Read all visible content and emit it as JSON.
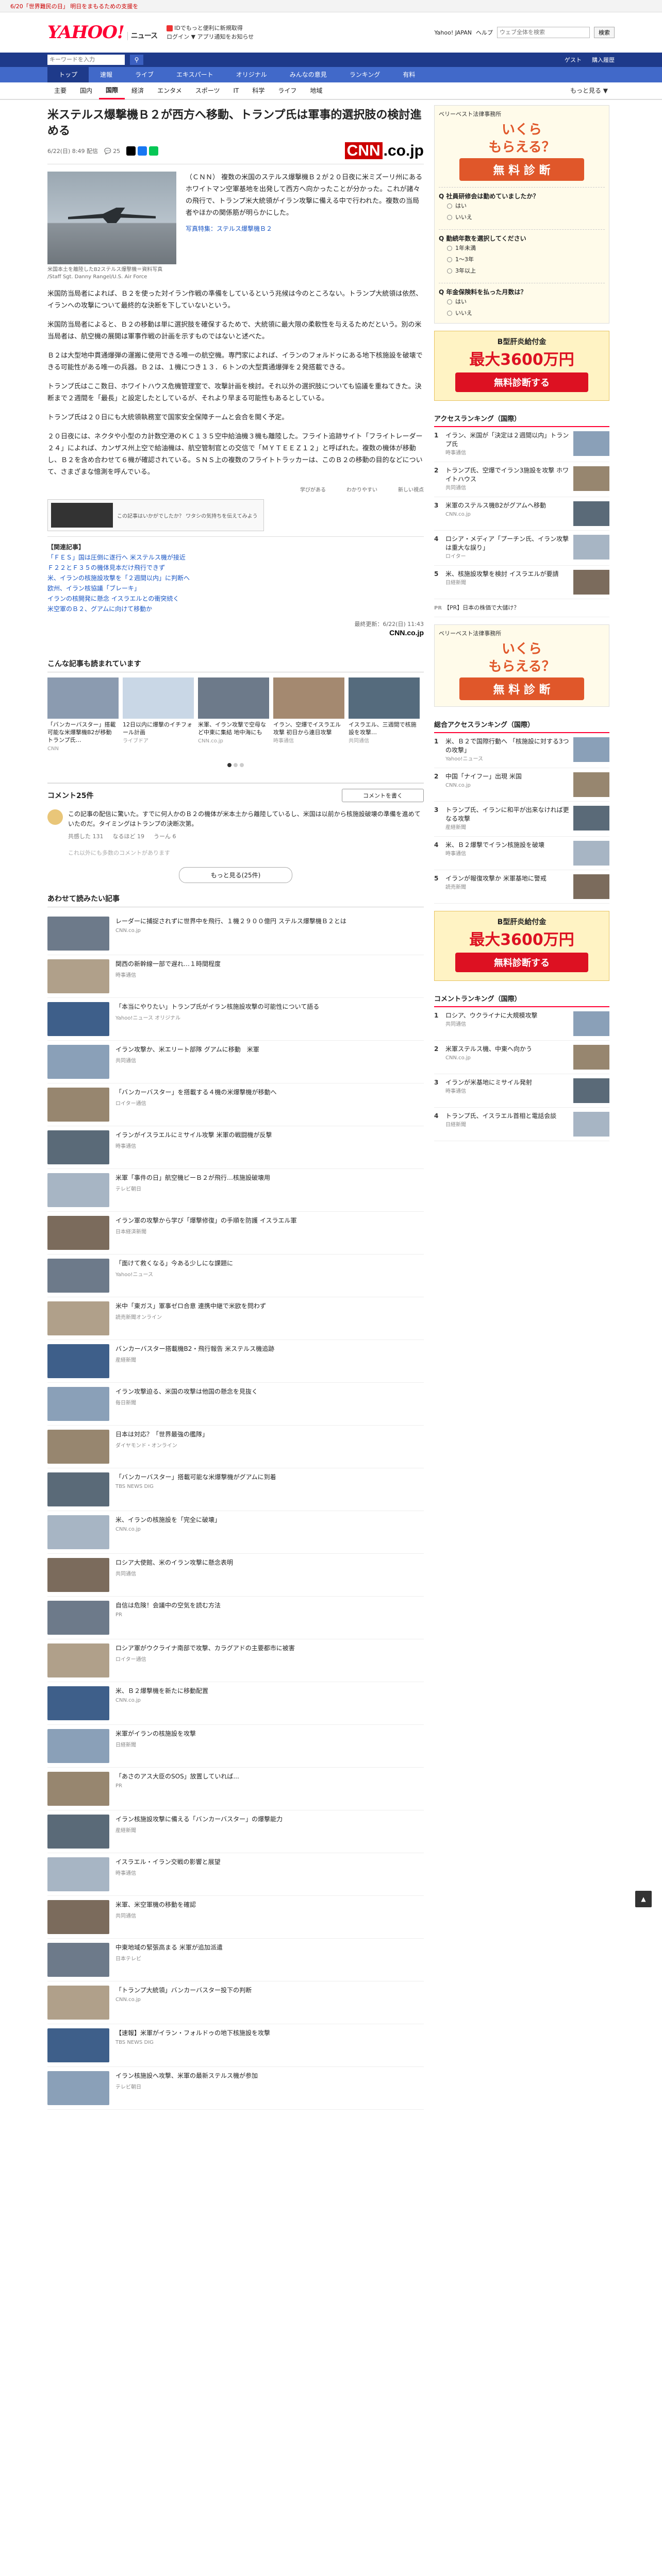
{
  "topbar": {
    "notice": "6/20「世界難民の日」 明日をまもるための支援を"
  },
  "header": {
    "logo": "YAHOO!",
    "logo_sub": "ニュース",
    "links": [
      "Yahoo! JAPAN",
      "ヘルプ"
    ],
    "login_text": "ログイン",
    "search_placeholder": "ウェブ全体を検索",
    "search_btn": "検索",
    "sub_links": [
      "IDでもっと便利に新規取得",
      "ログイン ▼ アプリ通知をお知らせ",
      "お得な特典ページ"
    ]
  },
  "nav": {
    "search_placeholder": "キーワードを入力",
    "right": [
      "ゲスト",
      "購入履歴"
    ]
  },
  "gnav": [
    "トップ",
    "速報",
    "ライブ",
    "エキスパート",
    "オリジナル",
    "みんなの意見",
    "ランキング",
    "有料"
  ],
  "snav": {
    "items": [
      "主要",
      "国内",
      "国際",
      "経済",
      "エンタメ",
      "スポーツ",
      "IT",
      "科学",
      "ライフ",
      "地域"
    ],
    "active": "国際",
    "right": "もっと見る ▼"
  },
  "article": {
    "title": "米ステルス爆撃機Ｂ２が西方へ移動、トランプ氏は軍事的選択肢の検討進める",
    "date": "6/22(日) 8:49 配信",
    "comments": "25",
    "brand": "CNN.co.jp",
    "caption": "米国本土を離陸したB2ステルス爆撃機＝資料写真 /Staff Sgt. Danny Rangel/U.S. Air Force",
    "photo_link": "写真特集：ステルス爆撃機Ｂ２",
    "lead": "（ＣＮＮ） 複数の米国のステルス爆撃機Ｂ２が２０日夜に米ミズーリ州にあるホワイトマン空軍基地を出発して西方へ向かったことが分かった。これが諸々の飛行で、トランプ米大統領がイラン攻撃に備える中で行われた。複数の当局者やほかの関係筋が明らかにした。",
    "paras": [
      "米国防当局者によれば、Ｂ２を使った対イラン作戦の準備をしているという兆候は今のところない。トランプ大統領は依然、イランへの攻撃について最終的な決断を下していないという。",
      "米国防当局者によると、Ｂ２の移動は単に選択肢を確保するためで、大統領に最大限の柔軟性を与えるためだという。別の米当局者は、航空機の展開は軍事作戦の計画を示すものではないと述べた。",
      "Ｂ２は大型地中貫通爆弾の運搬に使用できる唯一の航空機。専門家によれば、イランのフォルドゥにある地下核施設を破壊できる可能性がある唯一の兵器。Ｂ２は、１機につき１３．６トンの大型貫通爆弾を２発搭載できる。",
      "トランプ氏はここ数日、ホワイトハウス危機管理室で、攻撃計画を検討。それ以外の選択肢についても協議を重ねてきた。決断まで２週間を「最長」と設定したとしているが、それより早まる可能性もあるとしている。",
      "トランプ氏は２０日にも大統領執務室で国家安全保障チームと会合を開く予定。",
      "２０日夜には、ネクタや小型のカ計数空港のＫＣ１３５空中給油機３機も離陸した。フライト追跡サイト「フライトレーダー２４」によれば、カンザス州上空で給油機は、航空管制官との交信で「ＭＹＴＥＥＺ１２」と呼ばれた。複数の機体が移動し、Ｂ２を含め合わせて６機が確認されている。ＳＮＳ上の複数のフライトトラッカーは、このＢ２の移動の目的などについて、さまざまな憶測を呼んでいる。"
    ],
    "ad_text": "この記事はいかがでしたか？ ワタシの気持ちを伝えてみよう",
    "reactions": [
      "学びがある",
      "わかりやすい",
      "新しい視点"
    ],
    "related_title": "【関連記事】",
    "related": [
      "「ＦＥＳ」国は圧倒に遂行へ 米ステルス機が接近",
      "Ｆ２２とＦ３５の機体見本だけ飛行できず",
      "米、イランの核施設攻撃を「２週間以内」に判断へ",
      "欧州、イラン核協議「ブレーキ」",
      "イランの核開発に懸念 イスラエルとの衝突続く",
      "米空軍のＢ２、グアムに向けて移動か"
    ],
    "source": "最終更新：6/22(日) 11:43",
    "source_brand": "CNN.co.jp"
  },
  "also_read": {
    "title": "こんな記事も読まれています",
    "cards": [
      {
        "t": "「バンカーバスター」搭載可能な米爆撃機B2が移動 トランプ氏…",
        "s": "CNN"
      },
      {
        "t": "12日以内に爆撃のイチフォール計画",
        "s": "ライブドア"
      },
      {
        "t": "米軍、イラン攻撃で空母など中東に集結 地中海にも",
        "s": "CNN.co.jp"
      },
      {
        "t": "イラン、空爆でイスラエル攻撃 初日から連日攻撃",
        "s": "時事通信"
      },
      {
        "t": "イスラエル、三週間で核施設を攻撃…",
        "s": "共同通信"
      }
    ]
  },
  "comments": {
    "title": "コメント25件",
    "btn": "コメントを書く",
    "items": [
      {
        "text": "この記事の配信に驚いた。すでに何人かのＢ２の機体が米本土から離陸しているし、米国は以前から核施設破壊の準備を進めていたのだ。タイミングはトランプの決断次第。",
        "meta": [
          "共感した",
          "なるほど",
          "うーん"
        ],
        "counts": [
          "131",
          "19",
          "6"
        ]
      }
    ],
    "hidden": "これ以外にも多数のコメントがあります",
    "more": "もっと見る(25件)"
  },
  "recommend": {
    "title": "あわせて読みたい記事",
    "items": [
      {
        "t": "レーダーに捕捉されずに世界中を飛行、１機２９００億円 ステルス爆撃機Ｂ２とは",
        "s": "CNN.co.jp"
      },
      {
        "t": "関西の新幹線一部で遅れ…１時間程度",
        "s": "時事通信"
      },
      {
        "t": "「本当にやりたい」トランプ氏がイラン核施設攻撃の可能性について語る",
        "s": "Yahoo!ニュース オリジナル"
      },
      {
        "t": "イラン攻撃か、米エリート部隊 グアムに移動　米軍",
        "s": "共同通信"
      },
      {
        "t": "「バンカーバスター」を搭載する４機の米爆撃機が移動へ",
        "s": "ロイター通信"
      },
      {
        "t": "イランがイスラエルにミサイル攻撃 米軍の戦闘機が反撃",
        "s": "時事通信"
      },
      {
        "t": "米軍「事件の日」航空機ビーＢ２が飛行…核施設破壊用",
        "s": "テレビ朝日"
      },
      {
        "t": "イラン軍の攻撃から学び「爆撃修復」の手順を防護 イスラエル軍",
        "s": "日本経済新聞"
      },
      {
        "t": "「面けて救くなる」今ある少しにな課題に",
        "s": "Yahoo!ニュース"
      },
      {
        "t": "米中「東ガス」軍事ゼロ合意 連携中継で米欧を問わず",
        "s": "読売新聞オンライン"
      },
      {
        "t": "バンカーバスター搭載機B2・飛行報告 米ステルス機追跡",
        "s": "産経新聞"
      },
      {
        "t": "イラン攻撃迫る、米国の攻撃は他国の懸念を見抜く",
        "s": "毎日新聞"
      },
      {
        "t": "日本は対応？「世界最強の艦隊」",
        "s": "ダイヤモンド・オンライン"
      },
      {
        "t": "「バンカーバスター」搭載可能な米爆撃機がグアムに到着",
        "s": "TBS NEWS DIG"
      },
      {
        "t": "米、イランの核施設を「完全に破壊」",
        "s": "CNN.co.jp"
      },
      {
        "t": "ロシア大使館、米のイラン攻撃に懸念表明",
        "s": "共同通信"
      },
      {
        "t": "自信は危険！会議中の空気を読む方法",
        "s": "PR"
      },
      {
        "t": "ロシア軍がウクライナ南部で攻撃、カラグアドの主要都市に被害",
        "s": "ロイター通信"
      },
      {
        "t": "米、Ｂ２爆撃機を新たに移動配置",
        "s": "CNN.co.jp"
      },
      {
        "t": "米軍がイランの核施設を攻撃",
        "s": "日経新聞"
      },
      {
        "t": "「あさのアス大臣のSOS」放置していれば...",
        "s": "PR"
      },
      {
        "t": "イラン核施設攻撃に備える「バンカーバスター」の爆撃能力",
        "s": "産経新聞"
      },
      {
        "t": "イスラエル・イラン交戦の影響と展望",
        "s": "時事通信"
      },
      {
        "t": "米軍、米空軍機の移動を確認",
        "s": "共同通信"
      },
      {
        "t": "中東地域の緊張高まる 米軍が追加派遣",
        "s": "日本テレビ"
      },
      {
        "t": "「トランプ大統領」バンカーバスター投下の判断",
        "s": "CNN.co.jp"
      },
      {
        "t": "【速報】米軍がイラン・フォルドゥの地下核施設を攻撃",
        "s": "TBS NEWS DIG"
      },
      {
        "t": "イラン核施設へ攻撃、米軍の最新ステルス機が参加",
        "s": "テレビ朝日"
      }
    ]
  },
  "side": {
    "ad1": {
      "head": "ベリーベスト法律事務所",
      "big": "いくら",
      "big2": "もらえる？",
      "free": "無 料 診 断",
      "qs": [
        "Q 社員研修会は勤めていましたか？",
        "Q 勤続年数を選択してください",
        "Q 年金保険料を払った月数は？"
      ]
    },
    "banner": {
      "t1": "B型肝炎給付金",
      "t2": "最大3600万円",
      "t3": "無料診断する"
    },
    "access_title": "アクセスランキング（国際）",
    "access": [
      {
        "t": "イラン、米国が「決定は２週間以内」トランプ氏",
        "s": "時事通信"
      },
      {
        "t": "トランプ氏、空爆でイラン3施設を攻撃 ホワイトハウス",
        "s": "共同通信"
      },
      {
        "t": "米軍のステルス機B2がグアムへ移動",
        "s": "CNN.co.jp"
      },
      {
        "t": "ロシア・メディア「プーチン氏、イラン攻撃は重大な誤り」",
        "s": "ロイター"
      },
      {
        "t": "米、核施設攻撃を検討 イスラエルが要請",
        "s": "日経新聞"
      }
    ],
    "pr": "【PR】日本の株価で大儲け？",
    "ranking_title": "総合アクセスランキング（国際）",
    "ranking": [
      {
        "t": "米、Ｂ２で国際行動へ 「核施設に対する3つの攻撃」",
        "s": "Yahoo!ニュース"
      },
      {
        "t": "中国「ナイフー」出現 米国",
        "s": "CNN.co.jp"
      },
      {
        "t": "トランプ氏、イランに和平が出来なければ更なる攻撃",
        "s": "産経新聞"
      },
      {
        "t": "米、Ｂ２爆撃でイラン核施設を破壊",
        "s": "時事通信"
      },
      {
        "t": "イランが報復攻撃か 米軍基地に警戒",
        "s": "読売新聞"
      }
    ],
    "comment_rank_title": "コメントランキング（国際）",
    "comment_rank": [
      {
        "t": "ロシア、ウクライナに大規模攻撃",
        "s": "共同通信"
      },
      {
        "t": "米軍ステルス機、中東へ向かう",
        "s": "CNN.co.jp"
      },
      {
        "t": "イランが米基地にミサイル発射",
        "s": "時事通信"
      },
      {
        "t": "トランプ氏、イスラエル首相と電話会談",
        "s": "日経新聞"
      }
    ]
  }
}
